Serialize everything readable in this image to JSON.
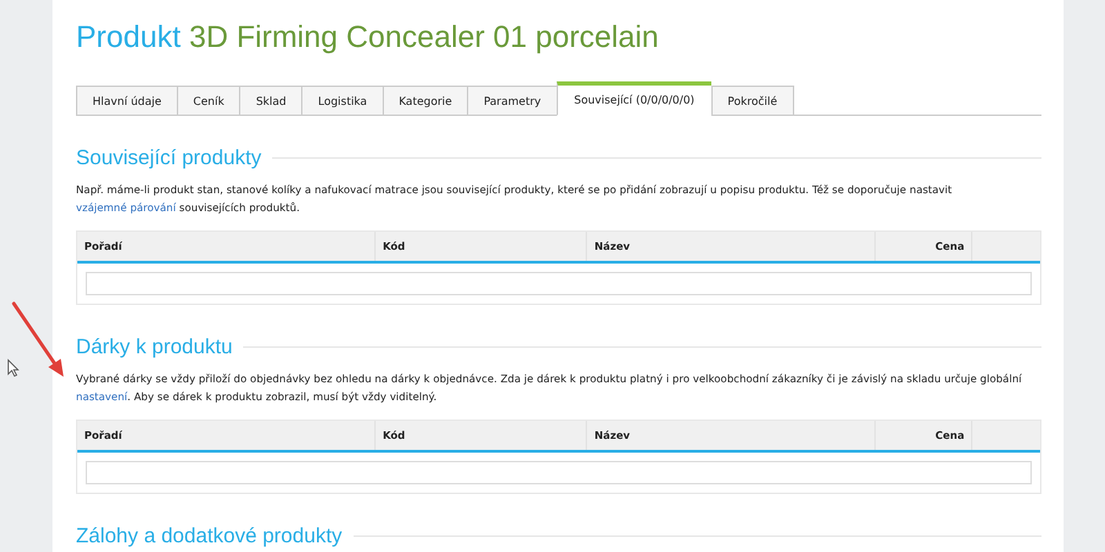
{
  "title": {
    "prefix": "Produkt",
    "product": "3D Firming Concealer 01 porcelain"
  },
  "tabs": [
    {
      "label": "Hlavní údaje",
      "selected": false
    },
    {
      "label": "Ceník",
      "selected": false
    },
    {
      "label": "Sklad",
      "selected": false
    },
    {
      "label": "Logistika",
      "selected": false
    },
    {
      "label": "Kategorie",
      "selected": false
    },
    {
      "label": "Parametry",
      "selected": false
    },
    {
      "label": "Související (0/0/0/0/0)",
      "selected": true
    },
    {
      "label": "Pokročilé",
      "selected": false
    }
  ],
  "sections": [
    {
      "title": "Související produkty",
      "text_before": "Např. máme-li produkt stan, stanové kolíky a nafukovací matrace jsou související produkty, které se po přidání zobrazují u popisu produktu. Též se doporučuje nastavit ",
      "link": "vzájemné párování",
      "text_after": " souvisejících produktů.",
      "columns": [
        "Pořadí",
        "Kód",
        "Název",
        "Cena"
      ]
    },
    {
      "title": "Dárky k produktu",
      "text_before": "Vybrané dárky se vždy přiloží do objednávky bez ohledu na dárky k objednávce. Zda je dárek k produktu platný i pro velkoobchodní zákazníky či je závislý na skladu určuje globální ",
      "link": "nastavení",
      "text_after": ". Aby se dárek k produktu zobrazil, musí být vždy viditelný.",
      "columns": [
        "Pořadí",
        "Kód",
        "Název",
        "Cena"
      ]
    },
    {
      "title": "Zálohy a dodatkové produkty"
    }
  ]
}
